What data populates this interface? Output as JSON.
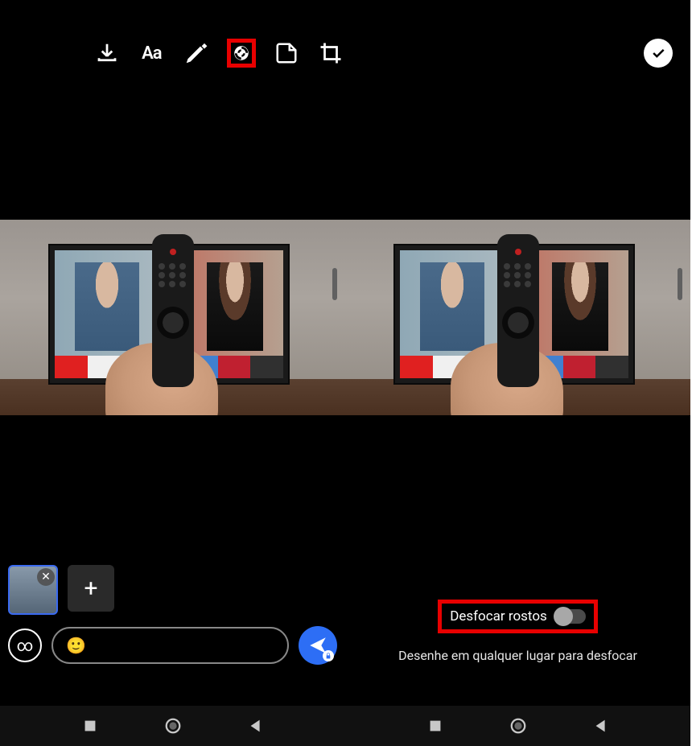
{
  "toolbar": {
    "text_tool": "Aa"
  },
  "thumbs": {
    "close_glyph": "✕",
    "add_glyph": "+"
  },
  "view_once_glyph": "∞",
  "caption_emoji": "🙂",
  "blur": {
    "toggle_label": "Desfocar rostos",
    "hint": "Desenhe em qualquer lugar para desfocar"
  }
}
